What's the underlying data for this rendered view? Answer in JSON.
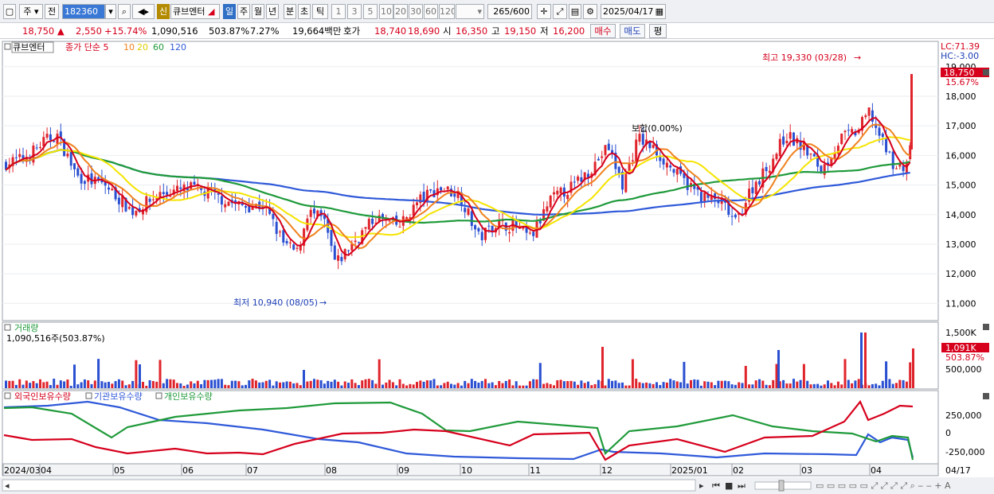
{
  "toolbar": {
    "period_day": "주",
    "period_all": "전",
    "code": "182360",
    "new_badge": "신",
    "name": "큐브엔터",
    "tabs": [
      "일",
      "주",
      "월",
      "년",
      "분",
      "초",
      "틱"
    ],
    "intervals": [
      "1",
      "3",
      "5",
      "10",
      "20",
      "30",
      "60",
      "120"
    ],
    "count": "265",
    "count_total": "/600",
    "date": "2025/04/17"
  },
  "quote": {
    "price": "18,750",
    "change": "2,550",
    "change_pct": "+15.74%",
    "volume": "1,090,516",
    "vol_ratio": "503.87%",
    "turnover": "7.27%",
    "amount": "19,664백만",
    "ask_label": "호가",
    "ask1": "18,740",
    "ask2": "18,690",
    "open_label": "시",
    "open": "16,350",
    "high_label": "고",
    "high": "19,150",
    "low_label": "저",
    "low": "16,200",
    "buy_button": "매수",
    "sell_button": "매도",
    "eval_button": "평"
  },
  "chart_data": [
    {
      "type": "candlestick",
      "legend_name": "큐브엔터",
      "legend_ma": "종가 단순 5",
      "ma_periods": [
        "10",
        "20",
        "60",
        "120"
      ],
      "ma_colors": {
        "5": "#d6001c",
        "10": "#f0821e",
        "20": "#f5e400",
        "60": "#1f9a3a",
        "120": "#2f59d9"
      },
      "y_ticks": [
        "19,000",
        "18,000",
        "17,000",
        "16,000",
        "15,000",
        "14,000",
        "13,000",
        "12,000",
        "11,000"
      ],
      "ylim": [
        10500,
        19800
      ],
      "lc": "LC:71.39",
      "hc": "HC:-3.00",
      "current_price": "18,750",
      "current_pct": "15.67%",
      "high_note": "최고 19,330 (03/28)",
      "low_note": "최저 10,940 (08/05)",
      "center_note": "보합(0.00%)",
      "x_labels": [
        "2024/03",
        "04",
        "05",
        "06",
        "07",
        "08",
        "09",
        "10",
        "11",
        "12",
        "2025/01",
        "02",
        "03",
        "04"
      ],
      "last_date": "04/17"
    },
    {
      "type": "bar",
      "title": "거래량",
      "value_text": "1,090,516주(503.87%)",
      "y_ticks": [
        "1,500K",
        "500,000"
      ],
      "current": "1,091K",
      "current_pct": "503.87%"
    },
    {
      "type": "line",
      "series": [
        {
          "name": "외국인보유수량",
          "color": "#d6001c"
        },
        {
          "name": "기관보유수량",
          "color": "#2f59d9"
        },
        {
          "name": "개인보유수량",
          "color": "#1f9a3a"
        }
      ],
      "y_ticks": [
        "250,000",
        "0",
        "-250,000"
      ]
    }
  ]
}
